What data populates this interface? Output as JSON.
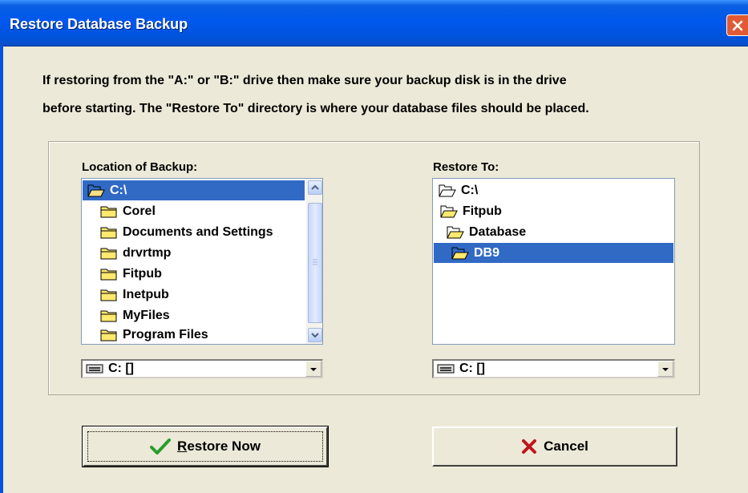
{
  "window": {
    "title": "Restore Database Backup"
  },
  "instructions": {
    "line1": "If restoring from the \"A:\" or \"B:\" drive then make sure your backup disk is in the drive",
    "line2": "before starting.  The \"Restore To\" directory is where your database files should be placed."
  },
  "backup": {
    "label": "Location of Backup:",
    "items": [
      "C:\\",
      "Corel",
      "Documents and Settings",
      "drvrtmp",
      "Fitpub",
      "Inetpub",
      "MyFiles",
      "Program Files"
    ],
    "drive": "C: []"
  },
  "restore": {
    "label": "Restore To:",
    "items": [
      "C:\\",
      "Fitpub",
      "Database",
      "DB9"
    ],
    "drive": "C: []"
  },
  "buttons": {
    "restore_label": "Restore Now",
    "restore_accel": "R",
    "cancel_label": "Cancel"
  },
  "icons": {
    "folder": "folder-icon",
    "open_folder": "open-folder-icon",
    "drive": "drive-icon",
    "check": "checkmark-icon",
    "cancel": "x-icon",
    "close": "close-icon"
  },
  "colors": {
    "titlebar": "#0058ee",
    "selection": "#316ac5",
    "dialog_bg": "#ece9d8",
    "close_button": "#e25a33",
    "check": "#2a9d2a",
    "cancel_x": "#c0141b"
  }
}
